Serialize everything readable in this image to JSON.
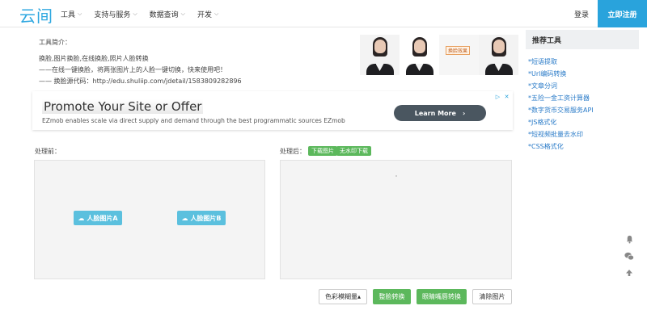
{
  "header": {
    "logo": "云间",
    "nav": [
      {
        "label": "工具"
      },
      {
        "label": "支持与服务"
      },
      {
        "label": "数据查询"
      },
      {
        "label": "开发"
      }
    ],
    "login": "登录",
    "register": "立即注册"
  },
  "intro": {
    "title": "工具简介：",
    "lines": [
      "换脸,图片换脸,在线换脸,照片人脸转换",
      "——在线一键换脸，将两张图片上的人脸一键切换，快来使用吧！",
      "—— 换脸源代码：http://edu.shuliip.com/jdetail/1583809282896"
    ]
  },
  "preview": {
    "stamp": "换脸效果"
  },
  "ad": {
    "headline": "Promote Your Site or Offer",
    "description": "EZmob enables scale via direct supply and demand through the best programmatic sources EZmob",
    "button": "Learn More",
    "icon_labels": [
      "▷",
      "✕"
    ]
  },
  "workspace": {
    "before_label": "处理前：",
    "after_label": "处理后：",
    "download_tag": "下载图片",
    "nowm_tag": "无水印下载",
    "upload_a": "人脸图片A",
    "upload_b": "人脸图片B"
  },
  "actions": {
    "blur": "色彩模糊量▴",
    "face_swap": "整脸转换",
    "eyes_swap": "眼睛嘴唇转换",
    "clear": "清除图片"
  },
  "sidebar": {
    "title": "推荐工具",
    "links": [
      "*短语提取",
      "*Url编码转换",
      "*文章分词",
      "*五险一金工资计算器",
      "*数字货币交易服务API",
      "*JS格式化",
      "*短视频批量去水印",
      "*CSS格式化"
    ]
  },
  "colors": {
    "brand": "#2ea7e0",
    "register_bg": "#29a3dc",
    "upload_btn": "#5bc0de",
    "green": "#5cb85c",
    "link": "#2a7bc8"
  },
  "icons": [
    "cloud-upload-icon",
    "chevron-down-icon",
    "bell-icon",
    "wechat-icon",
    "arrow-up-icon",
    "adchoices-icon",
    "close-icon",
    "chevron-right-icon"
  ]
}
